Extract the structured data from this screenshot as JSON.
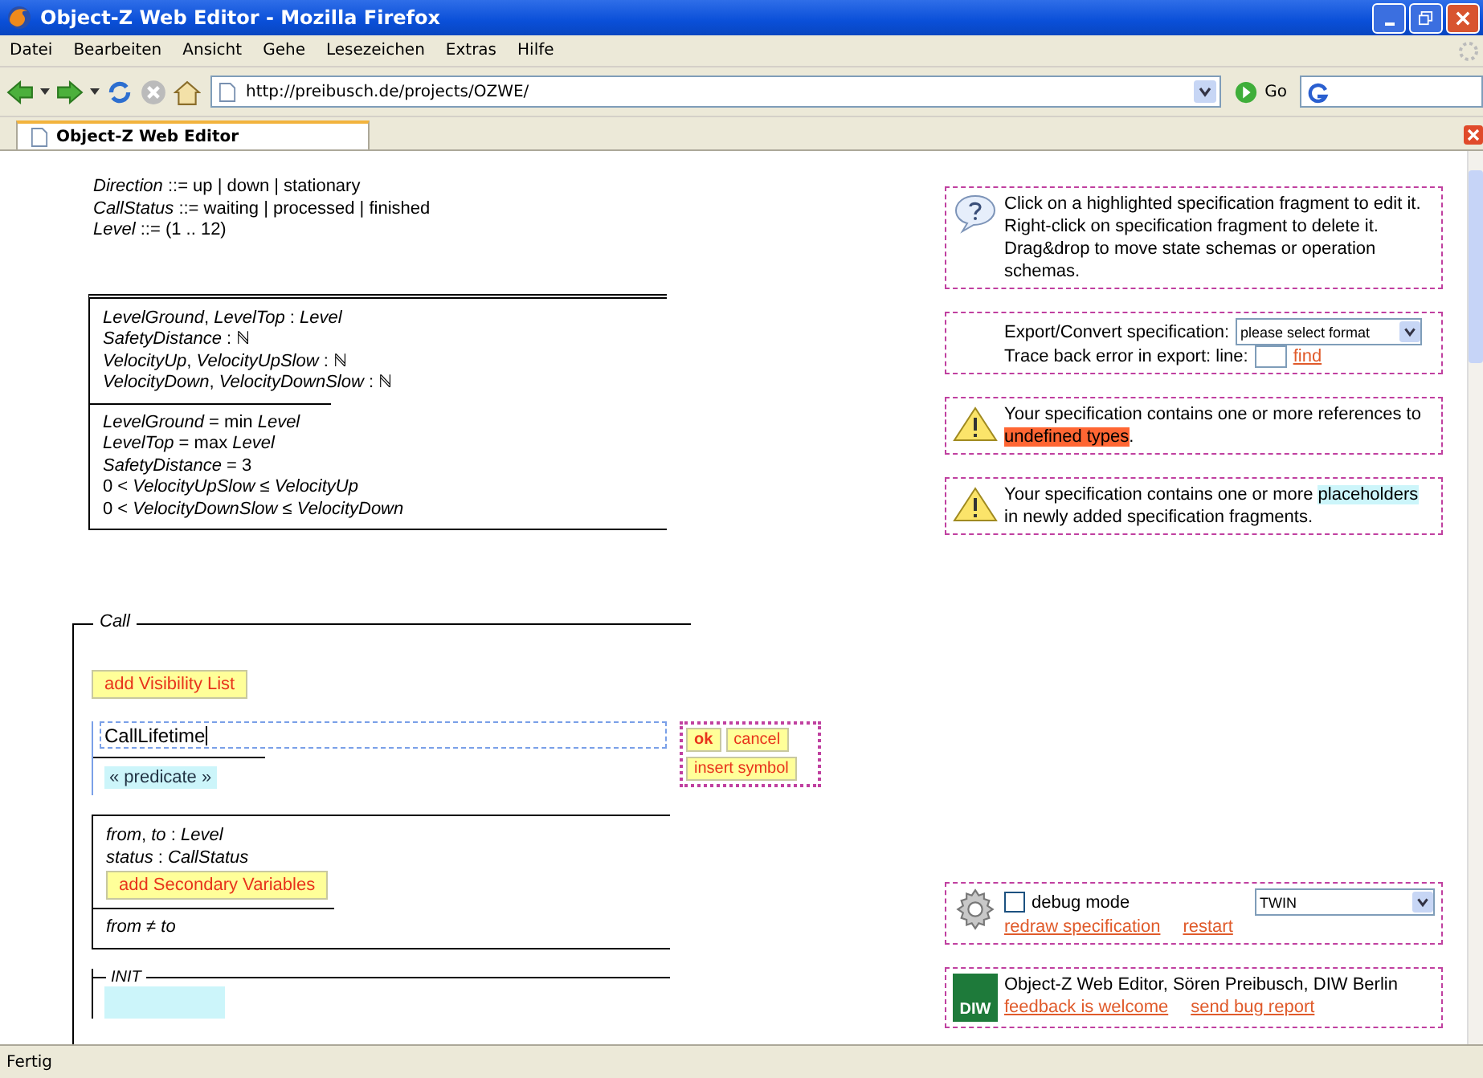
{
  "window": {
    "title": "Object-Z Web Editor - Mozilla Firefox"
  },
  "menu": [
    "Datei",
    "Bearbeiten",
    "Ansicht",
    "Gehe",
    "Lesezeichen",
    "Extras",
    "Hilfe"
  ],
  "toolbar": {
    "url": "http://preibusch.de/projects/OZWE/",
    "go_label": "Go"
  },
  "tabs": [
    {
      "label": "Object-Z Web Editor",
      "selected": true
    }
  ],
  "type_definitions": [
    "*Direction* ::= up | down | stationary",
    "*CallStatus* ::= waiting | processed | finished",
    "*Level* ::=  (1 .. 12)"
  ],
  "state_schema": {
    "declarations": [
      "*LevelGround*, *LevelTop* : *Level*",
      "*SafetyDistance* : ℕ",
      "*VelocityUp*, *VelocityUpSlow* : ℕ",
      "*VelocityDown*, *VelocityDownSlow* : ℕ"
    ],
    "predicates": [
      "*LevelGround* =  min  *Level*",
      "*LevelTop* =  max  *Level*",
      "*SafetyDistance* = 3",
      "0 < *VelocityUpSlow* ≤ *VelocityUp*",
      "0 < *VelocityDownSlow* ≤ *VelocityDown*"
    ]
  },
  "class_schema": {
    "name": "Call",
    "visibility_button": "add Visibility List",
    "name_field": {
      "value": "CallLifetime"
    },
    "edit_buttons": [
      {
        "label": "ok",
        "kind": "primary"
      },
      {
        "label": "cancel",
        "kind": "plain"
      },
      {
        "label": "insert symbol",
        "kind": "plain"
      }
    ],
    "predicate_placeholder": "«  predicate  »",
    "state": {
      "declarations": [
        "*from*, *to* : *Level*",
        "*status* : *CallStatus*"
      ],
      "secondary_button": "add Secondary Variables",
      "predicates": [
        "*from* ≠ *to*"
      ]
    },
    "init": {
      "name": "INIT"
    }
  },
  "help": {
    "text": "Click on a highlighted specification fragment to edit it. Right-click on specification fragment to delete it. Drag&drop to move state schemas or operation schemas."
  },
  "export": {
    "label": "Export/Convert specification:",
    "format_select": "please select format",
    "trace_label": "Trace back error in export: line:",
    "find_link": "find"
  },
  "warnings": [
    {
      "before": "Your specification contains one or more references to ",
      "highlight": "undefined types",
      "after": ".",
      "kind": "error"
    },
    {
      "before": "Your specification contains one or more ",
      "highlight": "placeholders",
      "after": " in newly added specification fragments.",
      "kind": "placeholder"
    }
  ],
  "debug": {
    "label": "debug mode",
    "checked": false,
    "select": "TWIN",
    "links": [
      "redraw specification",
      "restart"
    ]
  },
  "credits": {
    "logo_text": "DIW",
    "text": "Object-Z Web Editor, Sören Preibusch, DIW Berlin",
    "links": [
      "feedback is welcome",
      "send bug report"
    ]
  },
  "status_bar": {
    "text": "Fertig"
  }
}
